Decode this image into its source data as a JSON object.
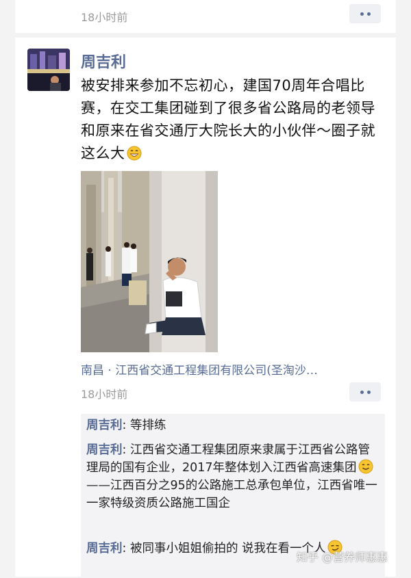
{
  "top_post": {
    "time": "18小时前"
  },
  "post": {
    "author": "周吉利",
    "text": "被安排来参加不忘初心，建国70周年合唱比赛，在交工集团碰到了很多省公路局的老领导和原来在省交通厅大院长大的小伙伴～圈子就这么大",
    "location": "南昌 · 江西省交通工程集团有限公司(圣淘沙…",
    "time": "18小时前"
  },
  "comments": [
    {
      "name": "周吉利",
      "text": ": 等排练"
    },
    {
      "name": "周吉利",
      "text": ": 江西省交通工程集团原来隶属于江西省公路管理局的国有企业，2017年整体划入江西省高速集团",
      "extra": "——江西百分之95的公路施工总承包单位，江西省唯一一家特级资质公路施工国企"
    },
    {
      "name": "周吉利",
      "text": ": 被同事小姐姐偷拍的  说我在看一个人"
    }
  ],
  "watermark": "知乎 @营养师惠惠"
}
